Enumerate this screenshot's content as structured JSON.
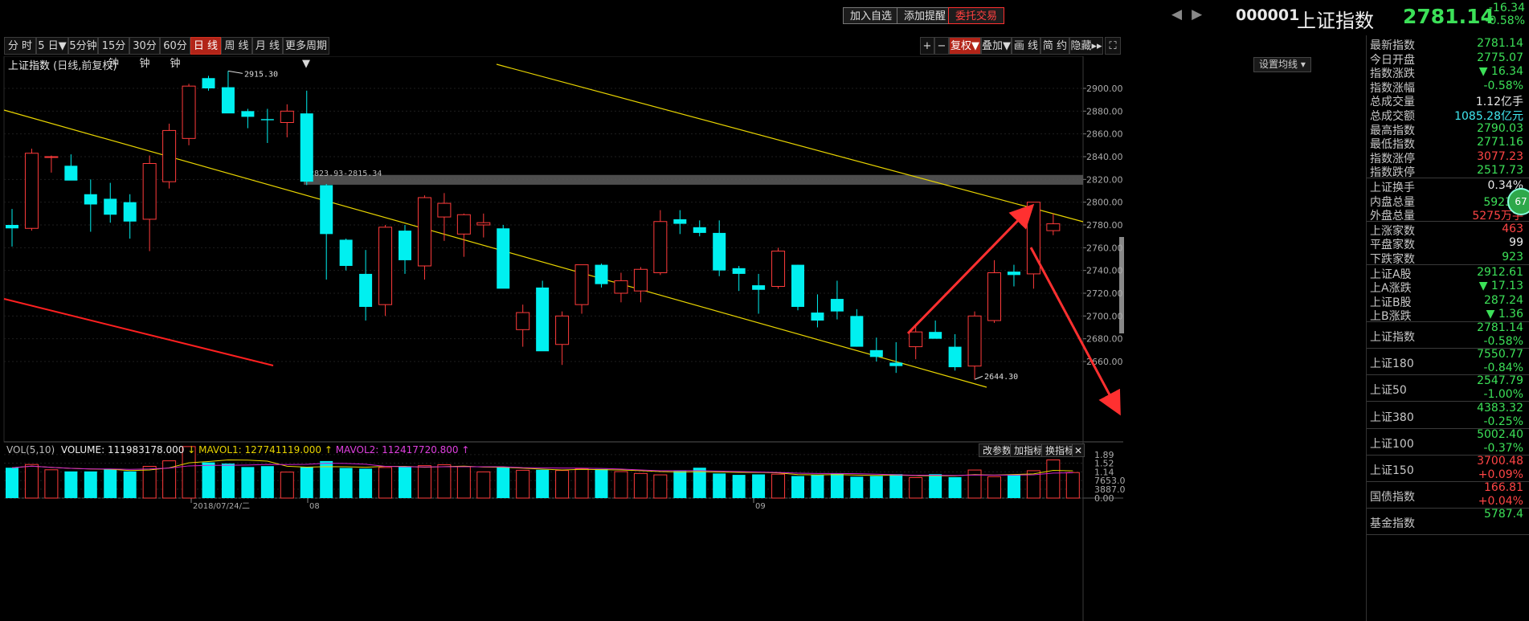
{
  "header": {
    "buttons": [
      "加入自选",
      "添加提醒",
      "委托交易"
    ],
    "code": "000001",
    "name": "上证指数",
    "price": "2781.14",
    "change": "-16.34",
    "change_pct": "-0.58%"
  },
  "period_tabs": [
    "分 时",
    "5 日▼",
    "5分钟",
    "15分钟",
    "30分钟",
    "60分钟",
    "日 线",
    "周 线",
    "月 线",
    "更多周期▼"
  ],
  "active_period": "日 线",
  "chart_tools": [
    "+",
    "−",
    "复权▼",
    "叠加▼",
    "画 线",
    "简 约",
    "隐藏▸▸"
  ],
  "chart": {
    "title": "上证指数",
    "subtitle": "(日线,前复权)",
    "ma_button": "设置均线",
    "high_label": "2915.30",
    "low_label": "2644.30",
    "gap_label": "2823.93-2815.34",
    "price_axis": [
      "2900.00",
      "2880.00",
      "2860.00",
      "2840.00",
      "2820.00",
      "2800.00",
      "2780.00",
      "2760.00",
      "2740.00",
      "2720.00",
      "2700.00",
      "2680.00",
      "2660.00"
    ],
    "volume_axis": [
      "1.89",
      "1.52",
      "1.14",
      "7653.00",
      "3887.00",
      "0.00"
    ],
    "date_labels": [
      "2018/07/24/二",
      "08",
      "09"
    ],
    "colors": {
      "up": "#ff3b3b",
      "down": "#00f0f0",
      "trendline": "#e8d400",
      "arrow": "#ff3030",
      "mavol1": "#e8d400",
      "mavol2": "#d020d0"
    }
  },
  "volume_legend": {
    "name": "VOL(5,10)",
    "volume_label": "VOLUME: 111983178.000",
    "mavol1_label": "MAVOL1: 127741119.000",
    "mavol2_label": "MAVOL2: 112417720.800",
    "buttons": [
      "改参数",
      "加指标",
      "换指标"
    ]
  },
  "panel": {
    "rows1": [
      {
        "label": "最新指数",
        "value": "2781.14",
        "color": "green"
      },
      {
        "label": "今日开盘",
        "value": "2775.07",
        "color": "green"
      },
      {
        "label": "指数涨跌",
        "value": "▼ 16.34",
        "color": "green"
      },
      {
        "label": "指数涨幅",
        "value": "-0.58%",
        "color": "green"
      },
      {
        "label": "总成交量",
        "value": "1.12亿手",
        "color": "white"
      },
      {
        "label": "总成交额",
        "value": "1085.28亿元",
        "color": "cyan"
      },
      {
        "label": "最高指数",
        "value": "2790.03",
        "color": "green"
      },
      {
        "label": "最低指数",
        "value": "2771.16",
        "color": "green"
      },
      {
        "label": "指数涨停",
        "value": "3077.23",
        "color": "red"
      },
      {
        "label": "指数跌停",
        "value": "2517.73",
        "color": "green"
      }
    ],
    "rows2": [
      {
        "label": "上证换手",
        "value": "0.34%",
        "color": "white"
      },
      {
        "label": "内盘总量",
        "value": "5923万",
        "color": "green"
      },
      {
        "label": "外盘总量",
        "value": "5275万手",
        "color": "red"
      }
    ],
    "badge": "67",
    "rows3": [
      {
        "label": "上涨家数",
        "value": "463",
        "color": "red"
      },
      {
        "label": "平盘家数",
        "value": "99",
        "color": "white"
      },
      {
        "label": "下跌家数",
        "value": "923",
        "color": "green"
      }
    ],
    "rows4": [
      {
        "label": "上证A股",
        "value": "2912.61",
        "color": "green"
      },
      {
        "label": "上A涨跌",
        "value": "▼ 17.13",
        "color": "green"
      },
      {
        "label": "上证B股",
        "value": "287.24",
        "color": "green"
      },
      {
        "label": "上B涨跌",
        "value": "▼ 1.36",
        "color": "green"
      }
    ],
    "indices": [
      {
        "label": "上证指数",
        "value": "2781.14",
        "pct": "-0.58%",
        "value_color": "green",
        "pct_color": "green"
      },
      {
        "label": "上证180",
        "value": "7550.77",
        "pct": "-0.84%",
        "value_color": "green",
        "pct_color": "green"
      },
      {
        "label": "上证50",
        "value": "2547.79",
        "pct": "-1.00%",
        "value_color": "green",
        "pct_color": "green"
      },
      {
        "label": "上证380",
        "value": "4383.32",
        "pct": "-0.25%",
        "value_color": "green",
        "pct_color": "green"
      },
      {
        "label": "上证100",
        "value": "5002.40",
        "pct": "-0.37%",
        "value_color": "green",
        "pct_color": "green"
      },
      {
        "label": "上证150",
        "value": "3700.48",
        "pct": "+0.09%",
        "value_color": "red",
        "pct_color": "red"
      },
      {
        "label": "国债指数",
        "value": "166.81",
        "pct": "+0.04%",
        "value_color": "red",
        "pct_color": "red"
      },
      {
        "label": "基金指数",
        "value": "5787.4",
        "pct": "",
        "value_color": "green",
        "pct_color": "green"
      }
    ]
  },
  "chart_data": {
    "type": "candlestick",
    "title": "上证指数",
    "price_range": [
      2644.3,
      2915.3
    ],
    "candles": [
      {
        "o": 2780,
        "h": 2794,
        "l": 2761,
        "c": 2777
      },
      {
        "o": 2777,
        "h": 2847,
        "l": 2775,
        "c": 2843
      },
      {
        "o": 2840,
        "h": 2841,
        "l": 2826,
        "c": 2840
      },
      {
        "o": 2832,
        "h": 2842,
        "l": 2820,
        "c": 2819
      },
      {
        "o": 2807,
        "h": 2820,
        "l": 2774,
        "c": 2798
      },
      {
        "o": 2803,
        "h": 2817,
        "l": 2782,
        "c": 2789
      },
      {
        "o": 2800,
        "h": 2807,
        "l": 2768,
        "c": 2783
      },
      {
        "o": 2785,
        "h": 2841,
        "l": 2757,
        "c": 2834
      },
      {
        "o": 2818,
        "h": 2869,
        "l": 2812,
        "c": 2863
      },
      {
        "o": 2856,
        "h": 2904,
        "l": 2850,
        "c": 2902
      },
      {
        "o": 2909,
        "h": 2911,
        "l": 2898,
        "c": 2900
      },
      {
        "o": 2901,
        "h": 2915.3,
        "l": 2879,
        "c": 2878
      },
      {
        "o": 2880,
        "h": 2882,
        "l": 2865,
        "c": 2875
      },
      {
        "o": 2873,
        "h": 2882,
        "l": 2852,
        "c": 2872
      },
      {
        "o": 2870,
        "h": 2886,
        "l": 2857,
        "c": 2880
      },
      {
        "o": 2878,
        "h": 2898,
        "l": 2815,
        "c": 2818
      },
      {
        "o": 2815,
        "h": 2816,
        "l": 2732,
        "c": 2772
      },
      {
        "o": 2767,
        "h": 2768,
        "l": 2740,
        "c": 2744
      },
      {
        "o": 2737,
        "h": 2758,
        "l": 2696,
        "c": 2708
      },
      {
        "o": 2710,
        "h": 2780,
        "l": 2700,
        "c": 2778
      },
      {
        "o": 2775,
        "h": 2780,
        "l": 2737,
        "c": 2749
      },
      {
        "o": 2744,
        "h": 2806,
        "l": 2732,
        "c": 2804
      },
      {
        "o": 2787,
        "h": 2808,
        "l": 2766,
        "c": 2799
      },
      {
        "o": 2772,
        "h": 2790,
        "l": 2752,
        "c": 2789
      },
      {
        "o": 2780,
        "h": 2790,
        "l": 2769,
        "c": 2782
      },
      {
        "o": 2777,
        "h": 2780,
        "l": 2726,
        "c": 2724
      },
      {
        "o": 2688,
        "h": 2710,
        "l": 2673,
        "c": 2703
      },
      {
        "o": 2725,
        "h": 2731,
        "l": 2670,
        "c": 2669
      },
      {
        "o": 2675,
        "h": 2704,
        "l": 2657,
        "c": 2700
      },
      {
        "o": 2710,
        "h": 2742,
        "l": 2702,
        "c": 2745
      },
      {
        "o": 2745,
        "h": 2746,
        "l": 2725,
        "c": 2728
      },
      {
        "o": 2720,
        "h": 2738,
        "l": 2712,
        "c": 2731
      },
      {
        "o": 2722,
        "h": 2743,
        "l": 2712,
        "c": 2741
      },
      {
        "o": 2738,
        "h": 2793,
        "l": 2736,
        "c": 2783
      },
      {
        "o": 2785,
        "h": 2793,
        "l": 2772,
        "c": 2781
      },
      {
        "o": 2778,
        "h": 2784,
        "l": 2770,
        "c": 2773
      },
      {
        "o": 2773,
        "h": 2784,
        "l": 2735,
        "c": 2740
      },
      {
        "o": 2742,
        "h": 2744,
        "l": 2722,
        "c": 2737
      },
      {
        "o": 2727,
        "h": 2737,
        "l": 2702,
        "c": 2723
      },
      {
        "o": 2726,
        "h": 2760,
        "l": 2724,
        "c": 2757
      },
      {
        "o": 2745,
        "h": 2745,
        "l": 2705,
        "c": 2708
      },
      {
        "o": 2703,
        "h": 2719,
        "l": 2690,
        "c": 2696
      },
      {
        "o": 2715,
        "h": 2731,
        "l": 2697,
        "c": 2704
      },
      {
        "o": 2700,
        "h": 2706,
        "l": 2673,
        "c": 2673
      },
      {
        "o": 2670,
        "h": 2681,
        "l": 2660,
        "c": 2664
      },
      {
        "o": 2659,
        "h": 2677,
        "l": 2650,
        "c": 2656
      },
      {
        "o": 2673,
        "h": 2691,
        "l": 2662,
        "c": 2686
      },
      {
        "o": 2686,
        "h": 2696,
        "l": 2681,
        "c": 2680
      },
      {
        "o": 2673,
        "h": 2684,
        "l": 2652,
        "c": 2655
      },
      {
        "o": 2656,
        "h": 2704,
        "l": 2644.3,
        "c": 2700
      },
      {
        "o": 2696,
        "h": 2749,
        "l": 2694,
        "c": 2738
      },
      {
        "o": 2739,
        "h": 2745,
        "l": 2726,
        "c": 2736
      },
      {
        "o": 2737,
        "h": 2800,
        "l": 2724,
        "c": 2800
      },
      {
        "o": 2775,
        "h": 2790,
        "l": 2771,
        "c": 2781
      }
    ],
    "volume_ymax": 2.2,
    "volumes": [
      1.32,
      1.46,
      1.23,
      1.16,
      1.16,
      1.26,
      1.16,
      1.38,
      1.62,
      2.24,
      1.55,
      1.5,
      1.35,
      1.39,
      1.13,
      1.36,
      1.61,
      1.31,
      1.28,
      1.33,
      1.37,
      1.41,
      1.45,
      1.37,
      1.14,
      1.34,
      1.21,
      1.23,
      1.2,
      1.27,
      1.26,
      1.15,
      1.07,
      1.01,
      1.18,
      1.32,
      1.07,
      1.01,
      1.03,
      1.04,
      0.96,
      1.01,
      1.06,
      0.93,
      0.96,
      1.04,
      0.89,
      1.04,
      0.91,
      1.22,
      0.93,
      1.02,
      1.19,
      1.66,
      1.11
    ],
    "series_names": [
      "VOL",
      "MAVOL1",
      "MAVOL2"
    ]
  }
}
